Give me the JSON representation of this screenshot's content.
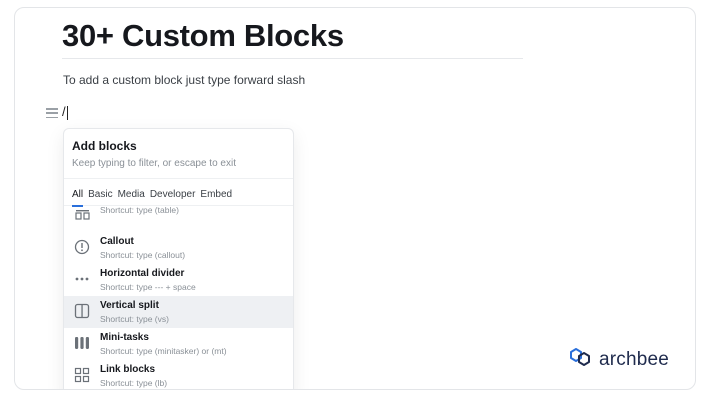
{
  "page": {
    "title": "30+ Custom Blocks",
    "intro": "To add a custom block just type forward slash",
    "slash_text": "/"
  },
  "menu": {
    "title": "Add blocks",
    "subtitle": "Keep typing to filter, or escape to exit",
    "tabs": [
      {
        "label": "All",
        "active": true
      },
      {
        "label": "Basic",
        "active": false
      },
      {
        "label": "Media",
        "active": false
      },
      {
        "label": "Developer",
        "active": false
      },
      {
        "label": "Embed",
        "active": false
      }
    ],
    "items": [
      {
        "name": "",
        "hint": "Shortcut: type (table)",
        "icon": "table-icon",
        "highlight": false
      },
      {
        "name": "Callout",
        "hint": "Shortcut: type (callout)",
        "icon": "alert-circle-icon",
        "highlight": false
      },
      {
        "name": "Horizontal divider",
        "hint": "Shortcut: type --- + space",
        "icon": "dots-horizontal-icon",
        "highlight": false
      },
      {
        "name": "Vertical split",
        "hint": "Shortcut: type (vs)",
        "icon": "split-columns-icon",
        "highlight": true
      },
      {
        "name": "Mini-tasks",
        "hint": "Shortcut: type (minitasker) or (mt)",
        "icon": "bars-icon",
        "highlight": false
      },
      {
        "name": "Link blocks",
        "hint": "Shortcut: type (lb)",
        "icon": "grid-icon",
        "highlight": false
      }
    ]
  },
  "brand": {
    "name": "archbee",
    "color": "#1f2b4d",
    "accent": "#2a6fdb"
  }
}
